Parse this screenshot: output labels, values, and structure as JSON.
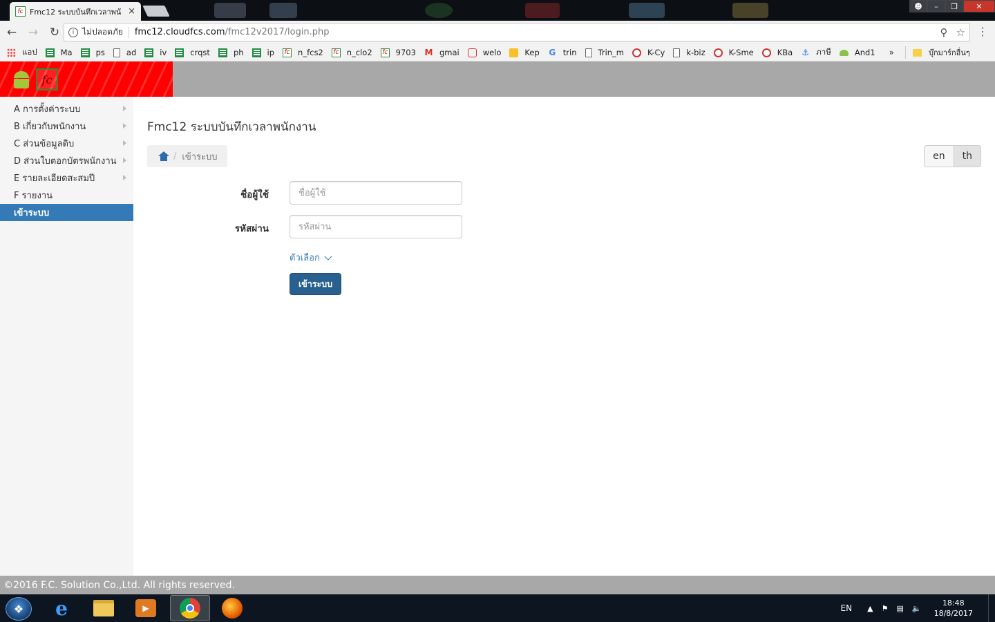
{
  "browser": {
    "tab_title": "Fmc12 ระบบบันทึกเวลาพนั",
    "tab_close": "×",
    "security_label": "ไม่ปลอดภัย",
    "url_host": "fmc12.cloudfcs.com",
    "url_path": "/fmc12v2017/login.php",
    "bookmarks": [
      {
        "label": "แอป",
        "icon": "apps-icon"
      },
      {
        "label": "Ma",
        "icon": "sheet-icon"
      },
      {
        "label": "ps",
        "icon": "sheet-icon"
      },
      {
        "label": "ad",
        "icon": "page-icon"
      },
      {
        "label": "iv",
        "icon": "sheet-icon"
      },
      {
        "label": "crqst",
        "icon": "sheet-icon"
      },
      {
        "label": "ph",
        "icon": "sheet-icon"
      },
      {
        "label": "ip",
        "icon": "sheet-icon"
      },
      {
        "label": "n_fcs2",
        "icon": "fc-icon"
      },
      {
        "label": "n_clo2",
        "icon": "fc-icon"
      },
      {
        "label": "9703",
        "icon": "fc-icon"
      },
      {
        "label": "gmai",
        "icon": "gmail-icon"
      },
      {
        "label": "welo",
        "icon": "bag-icon"
      },
      {
        "label": "Kep",
        "icon": "keep-icon"
      },
      {
        "label": "trin",
        "icon": "google-icon"
      },
      {
        "label": "Trin_m",
        "icon": "page-icon"
      },
      {
        "label": "K-Cy",
        "icon": "kbank-icon"
      },
      {
        "label": "k-biz",
        "icon": "page-icon"
      },
      {
        "label": "K-Sme",
        "icon": "kbank-icon"
      },
      {
        "label": "KBa",
        "icon": "kbank-icon"
      },
      {
        "label": "ภาษี",
        "icon": "link-icon"
      },
      {
        "label": "And1",
        "icon": "android-icon"
      }
    ],
    "bookmarks_more": "»",
    "other_bookmarks": "บุ๊กมาร์กอื่นๆ"
  },
  "app": {
    "sidebar": [
      {
        "label": "A การตั้งค่าระบบ",
        "has_submenu": true
      },
      {
        "label": "B เกี่ยวกับพนักงาน",
        "has_submenu": true
      },
      {
        "label": "C ส่วนข้อมูลดิบ",
        "has_submenu": true
      },
      {
        "label": "D ส่วนใบตอกบัตรพนักงาน",
        "has_submenu": true
      },
      {
        "label": "E รายละเอียดสะสมปี",
        "has_submenu": true
      },
      {
        "label": "F รายงาน",
        "has_submenu": false
      },
      {
        "label": "เข้าระบบ",
        "has_submenu": false,
        "active": true
      }
    ],
    "page_title": "Fmc12 ระบบบันทึกเวลาพนักงาน",
    "breadcrumb": {
      "separator": "/",
      "current": "เข้าระบบ"
    },
    "lang": {
      "en": "en",
      "th": "th",
      "selected": "th"
    },
    "form": {
      "username_label": "ชื่อผู้ใช้",
      "username_placeholder": "ชื่อผู้ใช้",
      "password_label": "รหัสผ่าน",
      "password_placeholder": "รหัสผ่าน",
      "options_label": "ตัวเลือก",
      "submit_label": "เข้าระบบ"
    },
    "footer": "©2016 F.C. Solution Co.,Ltd. All rights reserved."
  },
  "taskbar": {
    "lang": "EN",
    "time": "18:48",
    "date": "18/8/2017"
  },
  "colors": {
    "header_brand": "#ff0000",
    "header_bar": "#a8a8a8",
    "primary": "#337ab7",
    "button": "#286090"
  }
}
